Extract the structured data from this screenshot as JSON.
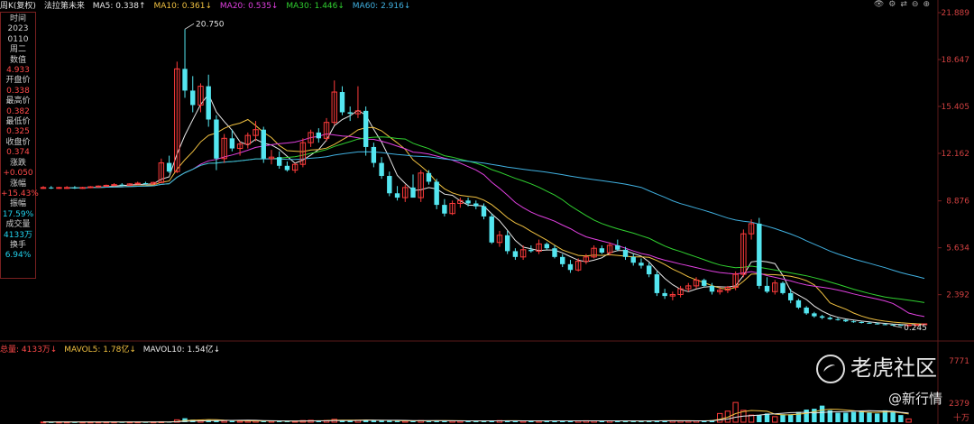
{
  "header": {
    "name": "周K(复权)",
    "stock": "法拉第未来",
    "ma": [
      {
        "label": "MA5: 0.338↑",
        "color": "#e8e8e8"
      },
      {
        "label": "MA10: 0.361↓",
        "color": "#f0c040"
      },
      {
        "label": "MA20: 0.535↓",
        "color": "#e040e0"
      },
      {
        "label": "MA30: 1.446↓",
        "color": "#30d030"
      },
      {
        "label": "MA60: 2.916↓",
        "color": "#40b0e0"
      }
    ],
    "icons": [
      "eye-icon",
      "gear-icon",
      "swap-icon",
      "minus-icon",
      "plus-icon"
    ]
  },
  "info_panel": [
    {
      "label": "时间",
      "value": ""
    },
    {
      "label": "2023",
      "value": ""
    },
    {
      "label": "0110",
      "value": ""
    },
    {
      "label": "周二",
      "value": ""
    },
    {
      "label": "数值",
      "value": "4.933",
      "color": "red"
    },
    {
      "label": "开盘价",
      "value": "0.338",
      "color": "red"
    },
    {
      "label": "最高价",
      "value": "0.382",
      "color": "red"
    },
    {
      "label": "最低价",
      "value": "0.325",
      "color": "red"
    },
    {
      "label": "收盘价",
      "value": "0.374",
      "color": "red"
    },
    {
      "label": "涨跌",
      "value": "+0.050",
      "color": "red"
    },
    {
      "label": "涨幅",
      "value": "+15.43%",
      "color": "red"
    },
    {
      "label": "振幅",
      "value": "17.59%",
      "color": "cyan"
    },
    {
      "label": "成交量",
      "value": "4133万",
      "color": "cyan"
    },
    {
      "label": "换手",
      "value": "6.94%",
      "color": "cyan"
    }
  ],
  "volume_header": {
    "total": "总量: 4133万↓",
    "mavol5": "MAVOL5: 1.78亿↓",
    "mavol10": "MAVOL10: 1.54亿↓"
  },
  "volume_axis": [
    "7771",
    "2379",
    "十万"
  ],
  "watermark": {
    "brand": "老虎社区",
    "sub": "@新行情"
  },
  "chart_data": {
    "type": "candlestick",
    "title": "",
    "price_axis_labels": [
      "21.889",
      "18.647",
      "15.405",
      "12.162",
      "8.876",
      "5.634",
      "2.392"
    ],
    "ylim": [
      0,
      21.889
    ],
    "annotations": [
      {
        "text": "20.750",
        "series": "high"
      },
      {
        "text": "0.245",
        "series": "low"
      }
    ],
    "candles": [
      {
        "o": 9.8,
        "h": 9.9,
        "l": 9.7,
        "c": 9.8
      },
      {
        "o": 9.8,
        "h": 9.9,
        "l": 9.7,
        "c": 9.75
      },
      {
        "o": 9.75,
        "h": 9.85,
        "l": 9.7,
        "c": 9.8
      },
      {
        "o": 9.8,
        "h": 9.9,
        "l": 9.7,
        "c": 9.8
      },
      {
        "o": 9.8,
        "h": 9.9,
        "l": 9.7,
        "c": 9.75
      },
      {
        "o": 9.75,
        "h": 9.85,
        "l": 9.7,
        "c": 9.8
      },
      {
        "o": 9.8,
        "h": 9.9,
        "l": 9.75,
        "c": 9.85
      },
      {
        "o": 9.85,
        "h": 9.95,
        "l": 9.8,
        "c": 9.9
      },
      {
        "o": 9.9,
        "h": 10.0,
        "l": 9.85,
        "c": 9.95
      },
      {
        "o": 9.95,
        "h": 10.1,
        "l": 9.9,
        "c": 10.0
      },
      {
        "o": 10.0,
        "h": 10.1,
        "l": 9.9,
        "c": 9.95
      },
      {
        "o": 9.95,
        "h": 10.1,
        "l": 9.9,
        "c": 10.05
      },
      {
        "o": 10.05,
        "h": 10.2,
        "l": 10.0,
        "c": 10.1
      },
      {
        "o": 10.1,
        "h": 10.2,
        "l": 10.0,
        "c": 10.05
      },
      {
        "o": 10.05,
        "h": 10.2,
        "l": 10.0,
        "c": 10.15
      },
      {
        "o": 10.15,
        "h": 11.8,
        "l": 10.1,
        "c": 11.5
      },
      {
        "o": 11.5,
        "h": 12.0,
        "l": 10.8,
        "c": 10.9
      },
      {
        "o": 10.9,
        "h": 18.5,
        "l": 10.8,
        "c": 18.0
      },
      {
        "o": 18.0,
        "h": 20.75,
        "l": 16.0,
        "c": 16.5
      },
      {
        "o": 16.5,
        "h": 17.5,
        "l": 15.0,
        "c": 15.5
      },
      {
        "o": 15.5,
        "h": 17.0,
        "l": 15.0,
        "c": 16.8
      },
      {
        "o": 16.8,
        "h": 17.6,
        "l": 14.0,
        "c": 14.5
      },
      {
        "o": 14.5,
        "h": 14.8,
        "l": 11.0,
        "c": 11.8
      },
      {
        "o": 11.8,
        "h": 13.5,
        "l": 11.5,
        "c": 13.2
      },
      {
        "o": 13.2,
        "h": 13.8,
        "l": 12.3,
        "c": 12.5
      },
      {
        "o": 12.5,
        "h": 13.0,
        "l": 12.0,
        "c": 12.8
      },
      {
        "o": 12.8,
        "h": 13.6,
        "l": 12.5,
        "c": 13.4
      },
      {
        "o": 13.4,
        "h": 14.4,
        "l": 13.0,
        "c": 13.8
      },
      {
        "o": 13.8,
        "h": 14.0,
        "l": 11.5,
        "c": 11.8
      },
      {
        "o": 11.8,
        "h": 12.4,
        "l": 11.4,
        "c": 11.9
      },
      {
        "o": 11.9,
        "h": 12.3,
        "l": 11.1,
        "c": 11.3
      },
      {
        "o": 11.3,
        "h": 11.6,
        "l": 10.9,
        "c": 11.0
      },
      {
        "o": 11.0,
        "h": 11.5,
        "l": 10.8,
        "c": 11.4
      },
      {
        "o": 11.4,
        "h": 13.2,
        "l": 11.2,
        "c": 12.9
      },
      {
        "o": 12.9,
        "h": 13.8,
        "l": 12.6,
        "c": 13.6
      },
      {
        "o": 13.6,
        "h": 13.9,
        "l": 12.9,
        "c": 13.2
      },
      {
        "o": 13.2,
        "h": 14.6,
        "l": 13.0,
        "c": 14.3
      },
      {
        "o": 14.3,
        "h": 17.2,
        "l": 14.1,
        "c": 16.4
      },
      {
        "o": 16.4,
        "h": 16.8,
        "l": 14.8,
        "c": 15.0
      },
      {
        "o": 15.0,
        "h": 15.4,
        "l": 14.4,
        "c": 14.9
      },
      {
        "o": 14.9,
        "h": 16.8,
        "l": 14.6,
        "c": 15.1
      },
      {
        "o": 15.1,
        "h": 15.4,
        "l": 12.0,
        "c": 12.6
      },
      {
        "o": 12.6,
        "h": 12.9,
        "l": 11.2,
        "c": 11.5
      },
      {
        "o": 11.5,
        "h": 11.9,
        "l": 10.4,
        "c": 10.6
      },
      {
        "o": 10.6,
        "h": 10.9,
        "l": 9.2,
        "c": 9.4
      },
      {
        "o": 9.4,
        "h": 9.9,
        "l": 8.9,
        "c": 9.1
      },
      {
        "o": 9.1,
        "h": 10.0,
        "l": 8.8,
        "c": 9.8
      },
      {
        "o": 9.8,
        "h": 10.7,
        "l": 9.5,
        "c": 9.1
      },
      {
        "o": 9.1,
        "h": 11.0,
        "l": 8.8,
        "c": 10.8
      },
      {
        "o": 10.8,
        "h": 11.0,
        "l": 10.0,
        "c": 10.2
      },
      {
        "o": 10.2,
        "h": 10.4,
        "l": 8.3,
        "c": 8.6
      },
      {
        "o": 8.6,
        "h": 9.0,
        "l": 7.8,
        "c": 8.0
      },
      {
        "o": 8.0,
        "h": 8.9,
        "l": 7.9,
        "c": 8.7
      },
      {
        "o": 8.7,
        "h": 9.1,
        "l": 8.4,
        "c": 8.9
      },
      {
        "o": 8.9,
        "h": 9.1,
        "l": 8.5,
        "c": 8.7
      },
      {
        "o": 8.7,
        "h": 8.9,
        "l": 8.3,
        "c": 8.5
      },
      {
        "o": 8.5,
        "h": 8.7,
        "l": 7.6,
        "c": 7.8
      },
      {
        "o": 7.8,
        "h": 8.0,
        "l": 5.9,
        "c": 6.0
      },
      {
        "o": 6.0,
        "h": 6.8,
        "l": 5.7,
        "c": 6.5
      },
      {
        "o": 6.5,
        "h": 6.8,
        "l": 5.2,
        "c": 5.4
      },
      {
        "o": 5.4,
        "h": 5.6,
        "l": 4.8,
        "c": 5.0
      },
      {
        "o": 5.0,
        "h": 5.8,
        "l": 4.8,
        "c": 5.5
      },
      {
        "o": 5.5,
        "h": 5.8,
        "l": 5.3,
        "c": 5.4
      },
      {
        "o": 5.4,
        "h": 6.2,
        "l": 5.2,
        "c": 5.9
      },
      {
        "o": 5.9,
        "h": 6.0,
        "l": 5.5,
        "c": 5.6
      },
      {
        "o": 5.6,
        "h": 5.8,
        "l": 4.9,
        "c": 5.0
      },
      {
        "o": 5.0,
        "h": 5.2,
        "l": 4.3,
        "c": 4.5
      },
      {
        "o": 4.5,
        "h": 4.8,
        "l": 3.9,
        "c": 4.1
      },
      {
        "o": 4.1,
        "h": 4.9,
        "l": 4.0,
        "c": 4.7
      },
      {
        "o": 4.7,
        "h": 5.2,
        "l": 4.5,
        "c": 5.0
      },
      {
        "o": 5.0,
        "h": 5.8,
        "l": 4.9,
        "c": 5.6
      },
      {
        "o": 5.6,
        "h": 5.8,
        "l": 5.2,
        "c": 5.3
      },
      {
        "o": 5.3,
        "h": 6.0,
        "l": 5.1,
        "c": 5.8
      },
      {
        "o": 5.8,
        "h": 6.2,
        "l": 5.4,
        "c": 5.5
      },
      {
        "o": 5.5,
        "h": 5.7,
        "l": 4.8,
        "c": 5.0
      },
      {
        "o": 5.0,
        "h": 5.2,
        "l": 4.4,
        "c": 4.6
      },
      {
        "o": 4.6,
        "h": 4.9,
        "l": 4.2,
        "c": 4.4
      },
      {
        "o": 4.4,
        "h": 4.6,
        "l": 3.6,
        "c": 3.8
      },
      {
        "o": 3.8,
        "h": 4.0,
        "l": 2.3,
        "c": 2.5
      },
      {
        "o": 2.5,
        "h": 2.8,
        "l": 2.1,
        "c": 2.3
      },
      {
        "o": 2.3,
        "h": 2.6,
        "l": 2.0,
        "c": 2.4
      },
      {
        "o": 2.4,
        "h": 3.0,
        "l": 2.2,
        "c": 2.8
      },
      {
        "o": 2.8,
        "h": 3.2,
        "l": 2.6,
        "c": 3.0
      },
      {
        "o": 3.0,
        "h": 3.6,
        "l": 2.8,
        "c": 3.4
      },
      {
        "o": 3.4,
        "h": 3.5,
        "l": 2.9,
        "c": 3.0
      },
      {
        "o": 3.0,
        "h": 3.2,
        "l": 2.4,
        "c": 2.6
      },
      {
        "o": 2.6,
        "h": 2.9,
        "l": 2.4,
        "c": 2.7
      },
      {
        "o": 2.7,
        "h": 3.0,
        "l": 2.5,
        "c": 2.9
      },
      {
        "o": 2.9,
        "h": 4.0,
        "l": 2.7,
        "c": 3.8
      },
      {
        "o": 3.8,
        "h": 6.9,
        "l": 3.6,
        "c": 6.6
      },
      {
        "o": 6.6,
        "h": 7.6,
        "l": 6.2,
        "c": 7.3
      },
      {
        "o": 7.3,
        "h": 7.7,
        "l": 2.8,
        "c": 3.0
      },
      {
        "o": 3.0,
        "h": 3.6,
        "l": 2.5,
        "c": 2.6
      },
      {
        "o": 2.6,
        "h": 3.4,
        "l": 2.4,
        "c": 3.2
      },
      {
        "o": 3.2,
        "h": 3.3,
        "l": 2.4,
        "c": 2.5
      },
      {
        "o": 2.5,
        "h": 2.8,
        "l": 1.8,
        "c": 2.0
      },
      {
        "o": 2.0,
        "h": 2.1,
        "l": 1.4,
        "c": 1.5
      },
      {
        "o": 1.5,
        "h": 1.6,
        "l": 1.0,
        "c": 1.1
      },
      {
        "o": 1.1,
        "h": 1.2,
        "l": 0.8,
        "c": 0.9
      },
      {
        "o": 0.9,
        "h": 1.0,
        "l": 0.7,
        "c": 0.8
      },
      {
        "o": 0.8,
        "h": 0.9,
        "l": 0.65,
        "c": 0.7
      },
      {
        "o": 0.7,
        "h": 0.8,
        "l": 0.6,
        "c": 0.65
      },
      {
        "o": 0.65,
        "h": 0.7,
        "l": 0.5,
        "c": 0.55
      },
      {
        "o": 0.55,
        "h": 0.6,
        "l": 0.45,
        "c": 0.5
      },
      {
        "o": 0.5,
        "h": 0.55,
        "l": 0.4,
        "c": 0.45
      },
      {
        "o": 0.45,
        "h": 0.5,
        "l": 0.38,
        "c": 0.4
      },
      {
        "o": 0.4,
        "h": 0.45,
        "l": 0.33,
        "c": 0.35
      },
      {
        "o": 0.35,
        "h": 0.4,
        "l": 0.3,
        "c": 0.32
      },
      {
        "o": 0.32,
        "h": 0.35,
        "l": 0.245,
        "c": 0.3
      },
      {
        "o": 0.3,
        "h": 0.34,
        "l": 0.27,
        "c": 0.29
      },
      {
        "o": 0.29,
        "h": 0.33,
        "l": 0.28,
        "c": 0.31
      },
      {
        "o": 0.31,
        "h": 0.35,
        "l": 0.29,
        "c": 0.33
      },
      {
        "o": 0.338,
        "h": 0.382,
        "l": 0.325,
        "c": 0.374
      }
    ],
    "ma_lines": [
      {
        "name": "MA5",
        "color": "#e8e8e8"
      },
      {
        "name": "MA10",
        "color": "#f0c040"
      },
      {
        "name": "MA20",
        "color": "#e040e0"
      },
      {
        "name": "MA30",
        "color": "#30d030"
      },
      {
        "name": "MA60",
        "color": "#40b0e0"
      }
    ],
    "volume_unit": "十万",
    "volume_ylim": [
      0,
      7771
    ],
    "volumes": [
      20,
      15,
      18,
      20,
      15,
      18,
      20,
      22,
      25,
      30,
      25,
      28,
      30,
      28,
      32,
      60,
      55,
      300,
      500,
      320,
      250,
      260,
      230,
      180,
      160,
      140,
      150,
      170,
      190,
      150,
      140,
      120,
      130,
      210,
      240,
      190,
      220,
      360,
      260,
      230,
      250,
      300,
      210,
      190,
      170,
      160,
      150,
      180,
      200,
      170,
      220,
      190,
      160,
      150,
      140,
      150,
      210,
      180,
      200,
      170,
      160,
      150,
      170,
      160,
      190,
      180,
      170,
      160,
      170,
      180,
      170,
      160,
      170,
      150,
      160,
      170,
      160,
      180,
      200,
      190,
      180,
      170,
      160,
      170,
      190,
      260,
      1100,
      1400,
      2500,
      1500,
      900,
      900,
      1100,
      700,
      1000,
      1000,
      1300,
      1600,
      1700,
      2100,
      1500,
      1200,
      1200,
      1300,
      1400,
      1200,
      1100,
      1500,
      1300,
      900,
      413
    ]
  }
}
